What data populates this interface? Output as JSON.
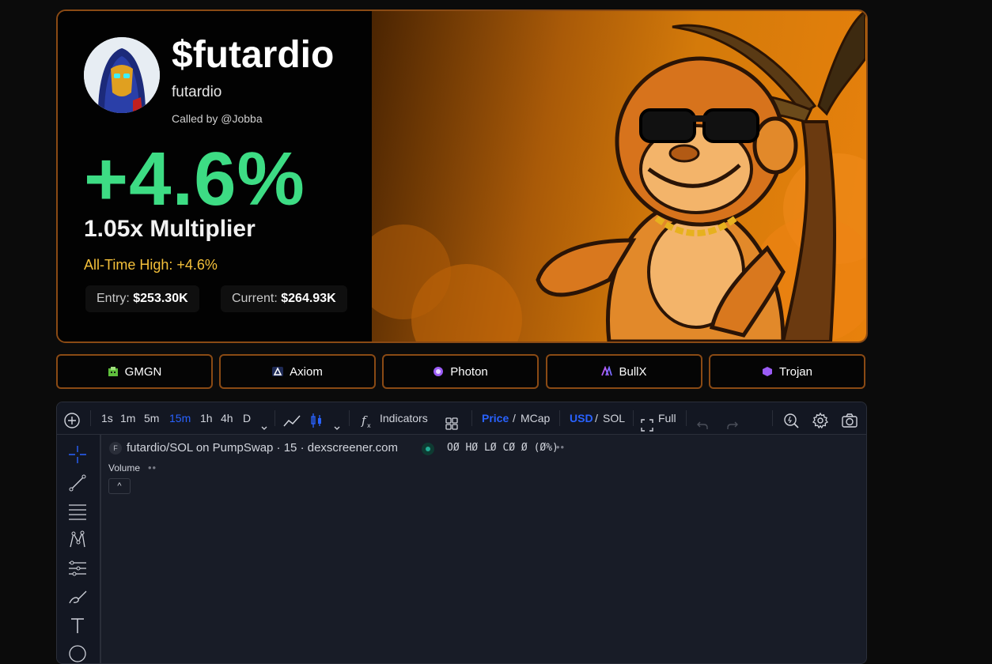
{
  "card": {
    "ticker": "$futardio",
    "name": "futardio",
    "caller": "Called by @Jobba",
    "change": "+4.6%",
    "multiplier": "1.05x Multiplier",
    "ath": "All-Time High: +4.6%",
    "entry_label": "Entry:",
    "entry_value": "$253.30K",
    "current_label": "Current:",
    "current_value": "$264.93K"
  },
  "platforms": [
    {
      "label": "GMGN",
      "icon": "gmgn-icon"
    },
    {
      "label": "Axiom",
      "icon": "axiom-icon"
    },
    {
      "label": "Photon",
      "icon": "photon-icon"
    },
    {
      "label": "BullX",
      "icon": "bullx-icon"
    },
    {
      "label": "Trojan",
      "icon": "trojan-icon"
    }
  ],
  "chart": {
    "intervals": [
      "1s",
      "1m",
      "5m",
      "15m",
      "1h",
      "4h",
      "D"
    ],
    "active_interval": "15m",
    "indicators_label": "Indicators",
    "price_label": "Price",
    "mcap_label": "MCap",
    "usd_label": "USD",
    "sol_label": "SOL",
    "full_label": "Full",
    "slash": "/",
    "symbol_badge": "F",
    "legend_title": "futardio/SOL on PumpSwap · 15 · dexscreener.com",
    "ohlc": "OØ HØ LØ CØ Ø (Ø%)",
    "volume_label": "Volume",
    "collapse_glyph": "^"
  },
  "colors": {
    "accent_green": "#3ddc84",
    "ath_yellow": "#f4c03a",
    "border_orange": "#8a4a14",
    "active_blue": "#2962ff"
  }
}
